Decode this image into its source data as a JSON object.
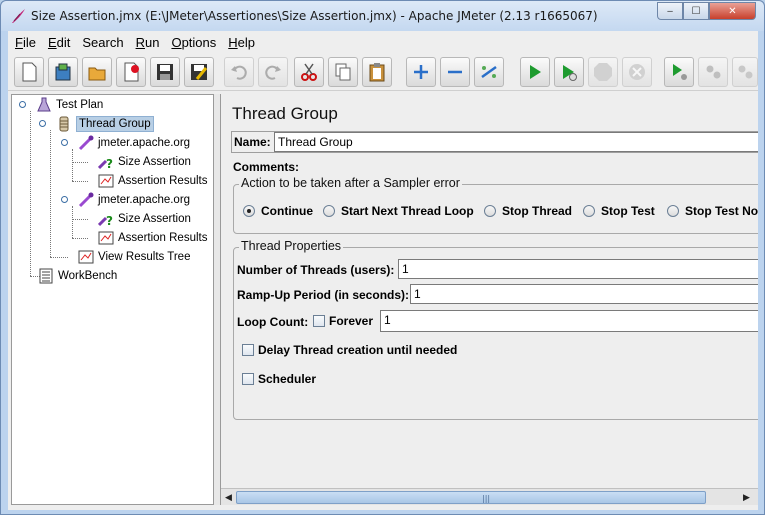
{
  "window": {
    "title": "Size Assertion.jmx (E:\\JMeter\\Assertiones\\Size Assertion.jmx) - Apache JMeter (2.13 r1665067)",
    "controls": {
      "minimize": "‒",
      "maximize": "☐",
      "close": "✕"
    }
  },
  "menu": [
    {
      "u": "F",
      "rest": "ile"
    },
    {
      "u": "E",
      "rest": "dit"
    },
    {
      "u": "",
      "rest": "Search"
    },
    {
      "u": "R",
      "rest": "un"
    },
    {
      "u": "O",
      "rest": "ptions"
    },
    {
      "u": "H",
      "rest": "elp"
    }
  ],
  "toolbar": {
    "icons": [
      "new-icon",
      "templates-icon",
      "open-icon",
      "close-file-icon",
      "save-icon",
      "save-as-icon",
      "undo-icon",
      "redo-icon",
      "cut-icon",
      "copy-icon",
      "paste-icon",
      "expand-icon",
      "collapse-icon",
      "toggle-icon",
      "start-icon",
      "start-no-pause-icon",
      "stop-icon",
      "shutdown-icon",
      "remote-start-icon",
      "remote-stop-icon",
      "remote-shutdown-icon"
    ]
  },
  "tree": {
    "items": [
      {
        "label": "Test Plan",
        "icon": "test-plan-icon"
      },
      {
        "label": "Thread Group",
        "icon": "thread-group-icon",
        "selected": true
      },
      {
        "label": "jmeter.apache.org",
        "icon": "sampler-icon"
      },
      {
        "label": "Size Assertion",
        "icon": "assertion-icon"
      },
      {
        "label": "Assertion Results",
        "icon": "listener-icon"
      },
      {
        "label": "jmeter.apache.org",
        "icon": "sampler-icon"
      },
      {
        "label": "Size Assertion",
        "icon": "assertion-icon"
      },
      {
        "label": "Assertion Results",
        "icon": "listener-icon"
      },
      {
        "label": "View Results Tree",
        "icon": "listener-icon"
      },
      {
        "label": "WorkBench",
        "icon": "workbench-icon"
      }
    ]
  },
  "panel": {
    "title": "Thread Group",
    "name_label": "Name:",
    "name_value": "Thread Group",
    "comments_label": "Comments:",
    "sampler_error": {
      "legend": "Action to be taken after a Sampler error",
      "options": [
        "Continue",
        "Start Next Thread Loop",
        "Stop Thread",
        "Stop Test",
        "Stop Test Now"
      ],
      "selected": "Continue"
    },
    "thread_properties": {
      "legend": "Thread Properties",
      "threads_label": "Number of Threads (users):",
      "threads_value": "1",
      "rampup_label": "Ramp-Up Period (in seconds):",
      "rampup_value": "1",
      "loop_label": "Loop Count:",
      "forever_label": "Forever",
      "loop_value": "1",
      "delay_label": "Delay Thread creation until needed",
      "scheduler_label": "Scheduler"
    }
  }
}
